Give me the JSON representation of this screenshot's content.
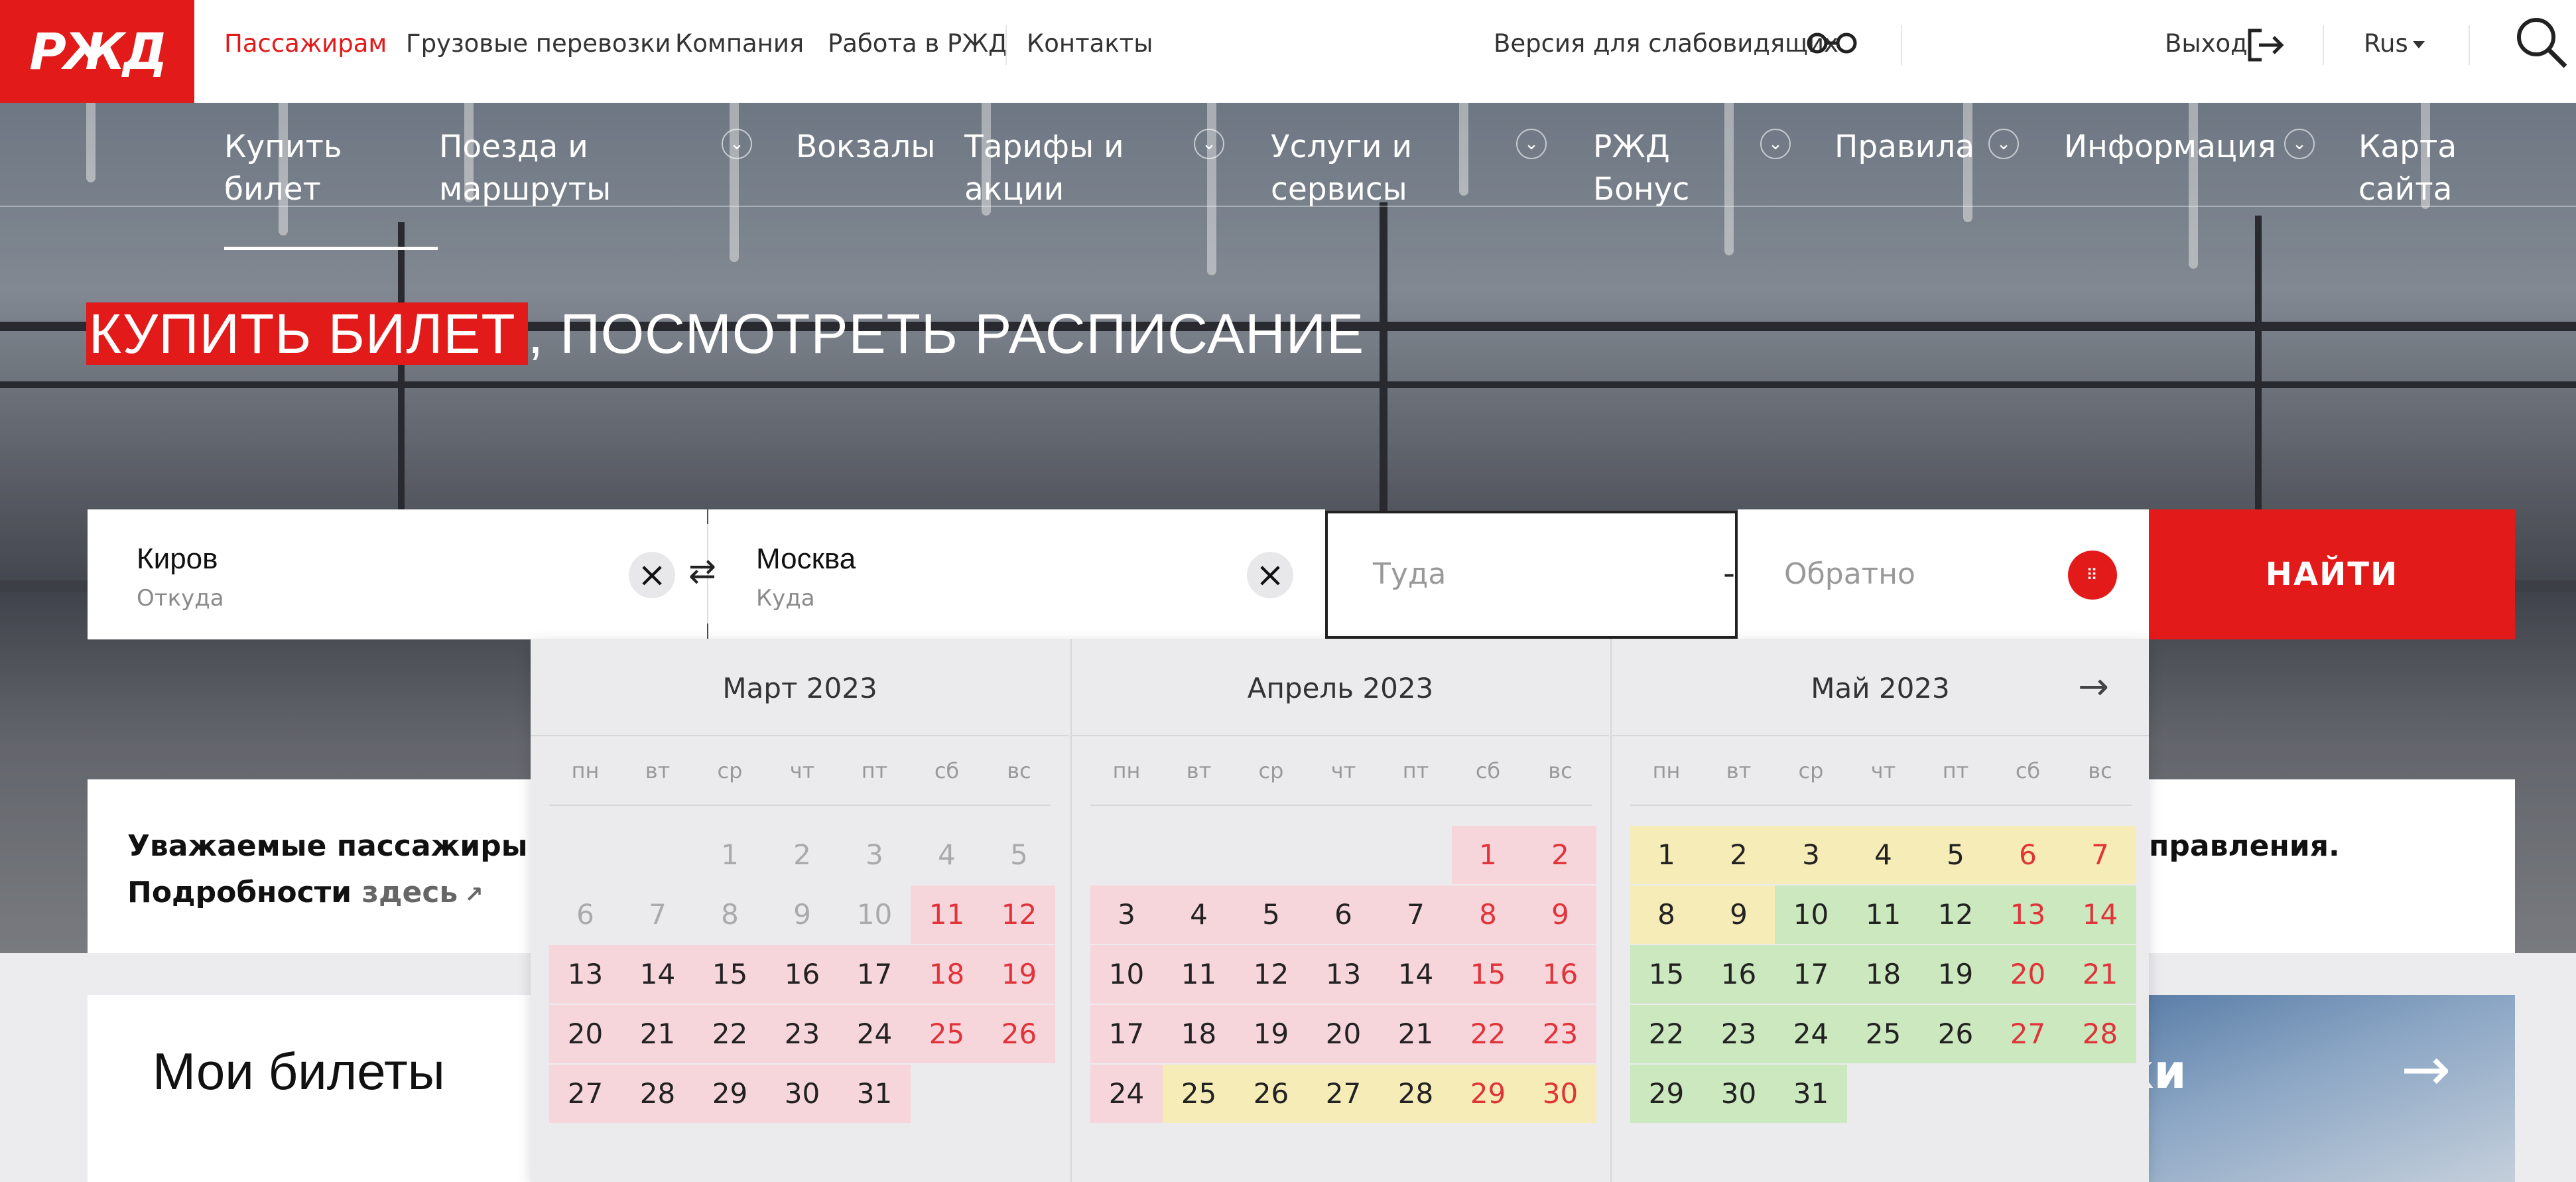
{
  "topbar": {
    "logo_text": "РЖД",
    "nav": [
      "Пассажирам",
      "Грузовые перевозки",
      "Компания",
      "Работа в РЖД",
      "Контакты"
    ],
    "accessibility": "Версия для слабовидящих",
    "logout": "Выход",
    "lang": "Rus"
  },
  "main_nav": [
    {
      "label": "Купить\nбилет"
    },
    {
      "label": "Поезда и\nмаршруты"
    },
    {
      "label": "Вокзалы"
    },
    {
      "label": "Тарифы и\nакции"
    },
    {
      "label": "Услуги и\nсервисы"
    },
    {
      "label": "РЖД\nБонус"
    },
    {
      "label": "Правила"
    },
    {
      "label": "Информация"
    },
    {
      "label": "Карта\nсайта"
    }
  ],
  "headline": {
    "highlight": "КУПИТЬ БИЛЕТ",
    "rest": ", ПОСМОТРЕТЬ РАСПИСАНИЕ"
  },
  "search": {
    "from_value": "Киров",
    "from_label": "Откуда",
    "to_value": "Москва",
    "to_label": "Куда",
    "date_there": "Туда",
    "date_back": "Обратно",
    "find_label": "НАЙТИ"
  },
  "notice": {
    "line1": "Уважаемые пассажиры! В",
    "line2": "Подробности ",
    "link": "здесь",
    "line1_end": "правления."
  },
  "cards": {
    "my_tickets": "Мои билеты",
    "second_partial": "ки"
  },
  "calendar": {
    "weekdays": [
      "пн",
      "вт",
      "ср",
      "чт",
      "пт",
      "сб",
      "вс"
    ],
    "months": [
      {
        "title": "Март 2023",
        "offset": 2,
        "days": 31,
        "past_until": 10,
        "pink_from": 11,
        "pink_to": 31,
        "yellow_from": 0,
        "green_from": 0
      },
      {
        "title": "Апрель 2023",
        "offset": 5,
        "days": 30,
        "past_until": 0,
        "pink_from": 1,
        "pink_to": 24,
        "yellow_from": 25,
        "green_from": 0
      },
      {
        "title": "Май 2023",
        "offset": 0,
        "days": 31,
        "past_until": 0,
        "pink_from": 0,
        "pink_to": 0,
        "yellow_from": 1,
        "yellow_to": 9,
        "green_from": 10
      }
    ]
  },
  "colors": {
    "accent": "#e21a1a",
    "pink": "#f7d6db",
    "yellow": "#f6ecb7",
    "green": "#cbe8bf"
  }
}
